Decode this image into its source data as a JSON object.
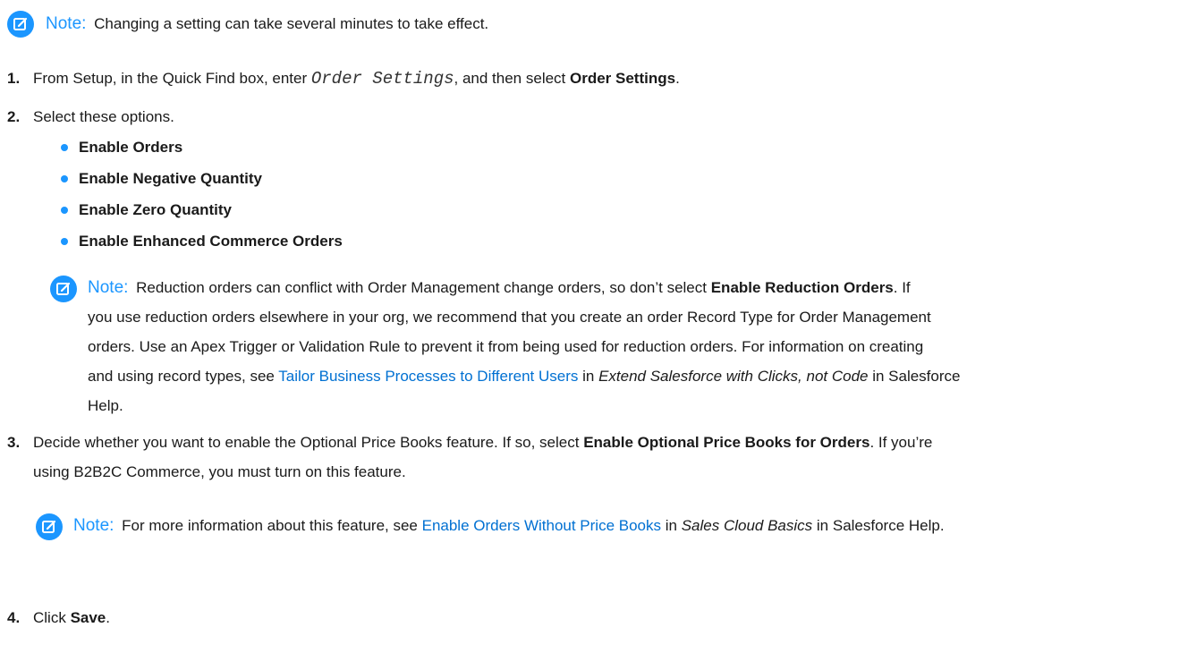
{
  "colors": {
    "accent": "#1b96ff",
    "link": "#0070d2",
    "text": "#1a1a1a"
  },
  "note_label": "Note:",
  "note1": {
    "text": "Changing a setting can take several minutes to take effect."
  },
  "steps": [
    {
      "num": "1.",
      "pre": "From Setup, in the Quick Find box, enter ",
      "code": "Order Settings",
      "mid": ", and then select ",
      "bold": "Order Settings",
      "post": "."
    },
    {
      "num": "2.",
      "text": "Select these options.",
      "options": [
        "Enable Orders",
        "Enable Negative Quantity",
        "Enable Zero Quantity",
        "Enable Enhanced Commerce Orders"
      ],
      "note": {
        "l1_pre": "Reduction orders can conflict with Order Management change orders, so don’t select ",
        "l1_bold": "Enable Reduction Orders",
        "l1_post": ". If",
        "l2": "you use reduction orders elsewhere in your org, we recommend that you create an order Record Type for Order Management",
        "l3": "orders. Use an Apex Trigger or Validation Rule to prevent it from being used for reduction orders. For information on creating",
        "l4_pre": "and using record types, see ",
        "l4_link": "Tailor Business Processes to Different Users",
        "l4_mid": " in ",
        "l4_ital": "Extend Salesforce with Clicks, not Code",
        "l4_post": " in Salesforce",
        "l5": "Help."
      }
    },
    {
      "num": "3.",
      "l1_pre": "Decide whether you want to enable the Optional Price Books feature. If so, select ",
      "l1_bold": "Enable Optional Price Books for Orders",
      "l1_post": ". If you’re",
      "l2": "using B2B2C Commerce, you must turn on this feature.",
      "note": {
        "pre": "For more information about this feature, see ",
        "link": "Enable Orders Without Price Books",
        "mid": " in ",
        "ital": "Sales Cloud Basics",
        "post": " in Salesforce Help."
      }
    },
    {
      "num": "4.",
      "pre": "Click ",
      "bold": "Save",
      "post": "."
    }
  ]
}
